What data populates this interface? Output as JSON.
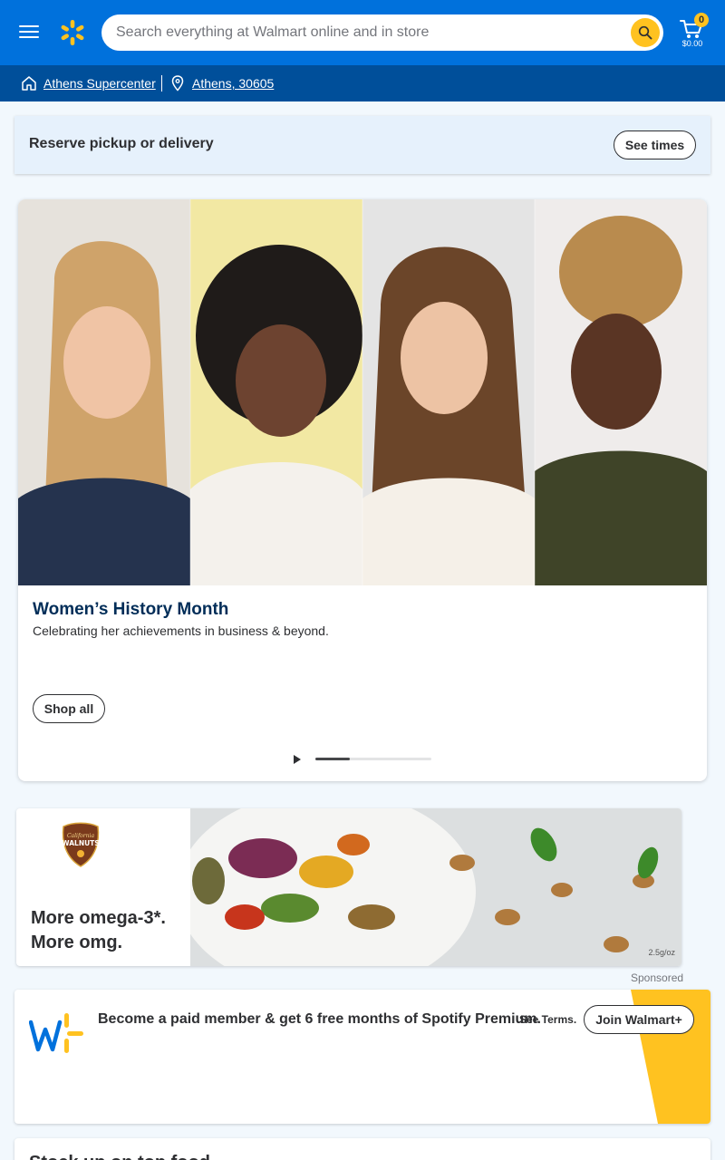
{
  "colors": {
    "header_blue": "#0071dc",
    "store_bar_blue": "#004f9a",
    "spark_yellow": "#ffc220",
    "hero_title_navy": "#002d58"
  },
  "header": {
    "menu_icon": "hamburger-menu-icon",
    "logo_icon": "walmart-spark-icon",
    "search_placeholder": "Search everything at Walmart online and in store",
    "search_icon": "search-icon",
    "cart_icon": "cart-icon",
    "cart_count": "0",
    "cart_total": "$0.00"
  },
  "store_bar": {
    "store_icon": "store-icon",
    "store_name": "Athens Supercenter",
    "location_icon": "location-pin-icon",
    "location": "Athens, 30605"
  },
  "reserve": {
    "title": "Reserve pickup or delivery",
    "button": "See times"
  },
  "hero": {
    "title": "Women’s History Month",
    "subtitle": "Celebrating her achievements in business & beyond.",
    "button": "Shop all",
    "play_icon": "play-icon",
    "carousel_progress": 0.3
  },
  "ad": {
    "logo_text_1": "California",
    "logo_text_2": "WALNUTS",
    "headline_line1": "More omega-3*.",
    "headline_line2": "More omg.",
    "note": "2.5g/oz",
    "sponsored": "Sponsored"
  },
  "walmart_plus": {
    "logo_icon": "walmart-plus-icon",
    "text": "Become a paid member & get 6 free months of Spotify Premium.",
    "terms": "See Terms.",
    "button": "Join Walmart+"
  },
  "next_section": {
    "title": "Stock up on top food"
  }
}
